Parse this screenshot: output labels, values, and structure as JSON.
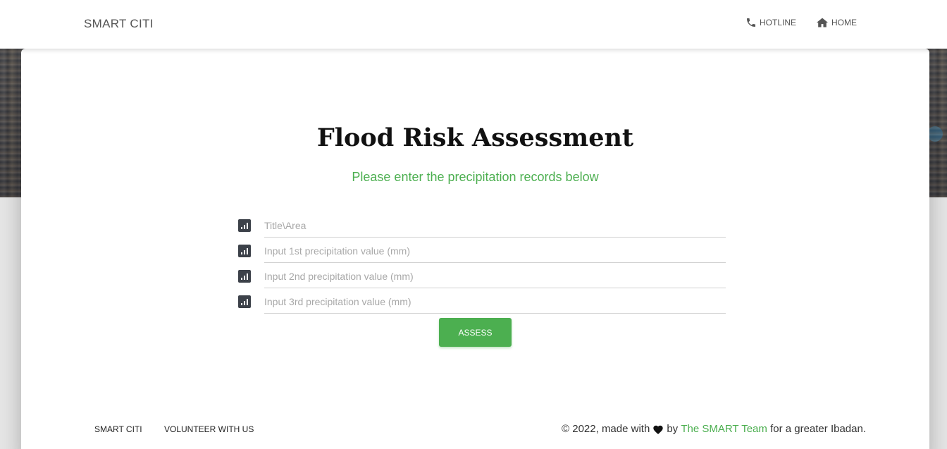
{
  "header": {
    "brand": "SMART CITI",
    "nav": [
      {
        "label": "HOTLINE",
        "icon": "phone-icon"
      },
      {
        "label": "HOME",
        "icon": "home-icon"
      }
    ]
  },
  "main": {
    "title": "Flood Risk Assessment",
    "subtitle": "Please enter the precipitation records below",
    "fields": [
      {
        "placeholder": "Title\\Area",
        "value": "",
        "icon": "bar-chart-icon"
      },
      {
        "placeholder": "Input 1st precipitation value (mm)",
        "value": "",
        "icon": "bar-chart-icon"
      },
      {
        "placeholder": "Input 2nd precipitation value (mm)",
        "value": "",
        "icon": "bar-chart-icon"
      },
      {
        "placeholder": "Input 3rd precipitation value (mm)",
        "value": "",
        "icon": "bar-chart-icon"
      }
    ],
    "submit_label": "ASSESS"
  },
  "footer": {
    "links": [
      "SMART CITI",
      "VOLUNTEER WITH US"
    ],
    "copyright_prefix": "© 2022, made with",
    "heart_icon": "heart-icon",
    "by_text": "by",
    "team_link": "The SMART Team",
    "suffix": "for a greater Ibadan."
  },
  "colors": {
    "accent": "#4caf50",
    "icon_bg": "#3c4149",
    "text_dark": "#111111"
  }
}
